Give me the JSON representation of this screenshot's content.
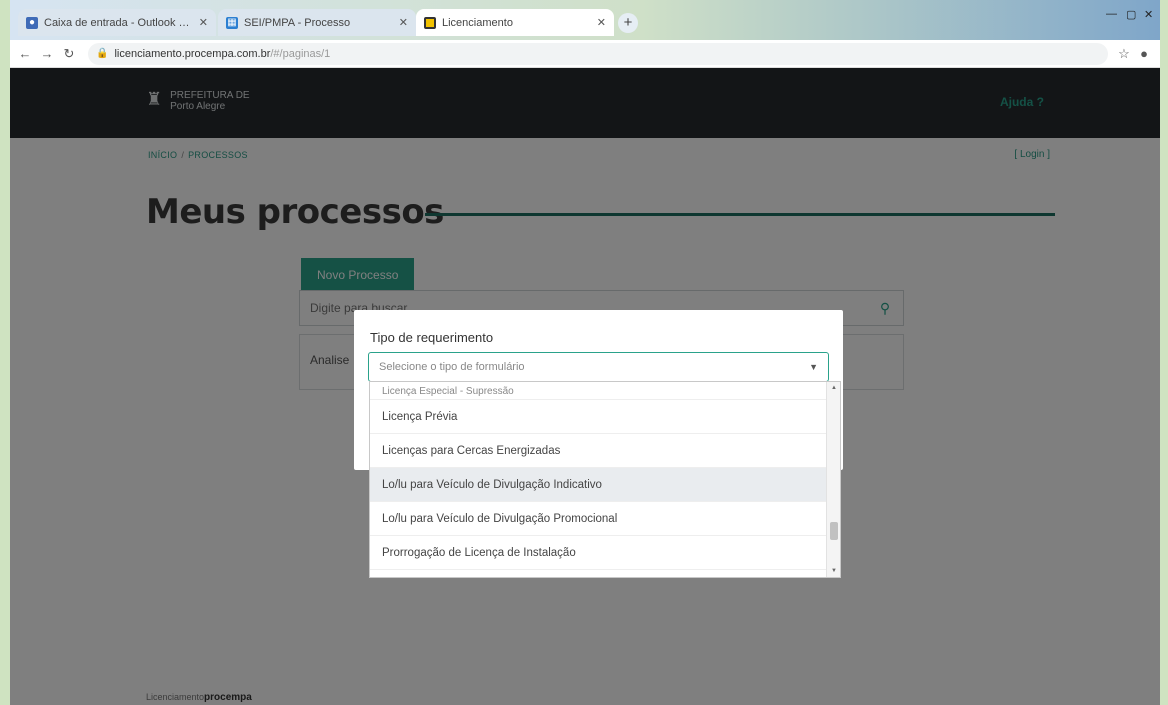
{
  "browser": {
    "tabs": [
      {
        "title": "Caixa de entrada - Outlook Pro",
        "active": false
      },
      {
        "title": "SEI/PMPA - Processo",
        "active": false
      },
      {
        "title": "Licenciamento",
        "active": true
      }
    ],
    "new_tab": "+",
    "url_host": "licenciamento.procempa.com.br",
    "url_path": "/#/paginas/1"
  },
  "site": {
    "logo_line1": "PREFEITURA DE",
    "logo_line2": "Porto Alegre",
    "help_label": "Ajuda",
    "breadcrumb": [
      "INÍCIO",
      "PROCESSOS"
    ],
    "login_label": "[ Login ]",
    "page_title": "Meus processos",
    "new_process_tab": "Novo Processo",
    "search_placeholder": "Digite para buscar",
    "result_label": "Analise",
    "footer_prefix": "Licenciamento",
    "footer_brand": "procempa"
  },
  "modal": {
    "label": "Tipo de requerimento",
    "select_placeholder": "Selecione o tipo de formulário",
    "options": [
      {
        "label": "Licença Especial - Supressão",
        "state": "partial"
      },
      {
        "label": "Licença Prévia",
        "state": "normal"
      },
      {
        "label": "Licenças para Cercas Energizadas",
        "state": "normal"
      },
      {
        "label": "Lo/lu para Veículo de Divulgação Indicativo",
        "state": "hover"
      },
      {
        "label": "Lo/lu para Veículo de Divulgação Promocional",
        "state": "normal"
      },
      {
        "label": "Prorrogação de Licença de Instalação",
        "state": "normal"
      }
    ]
  },
  "colors": {
    "accent": "#2aa28b",
    "header_bg": "#262b2f",
    "title_rule": "#1d6f61"
  }
}
